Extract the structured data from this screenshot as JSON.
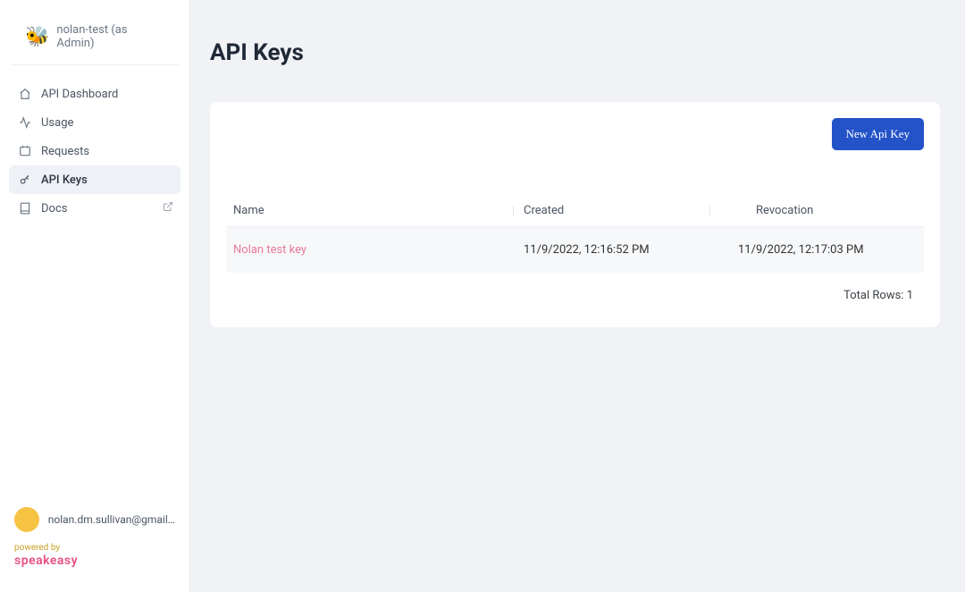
{
  "workspace": {
    "name": "nolan-test (as Admin)"
  },
  "sidebar": {
    "items": [
      {
        "label": "API Dashboard"
      },
      {
        "label": "Usage"
      },
      {
        "label": "Requests"
      },
      {
        "label": "API Keys"
      },
      {
        "label": "Docs"
      }
    ]
  },
  "user": {
    "email": "nolan.dm.sullivan@gmail..."
  },
  "footer": {
    "powered_by": "powered by",
    "brand": "speakeasy"
  },
  "page": {
    "title": "API Keys"
  },
  "toolbar": {
    "new_api_key_label": "New Api Key"
  },
  "table": {
    "columns": {
      "name": "Name",
      "created": "Created",
      "revocation": "Revocation"
    },
    "rows": [
      {
        "name": "Nolan test key",
        "created": "11/9/2022, 12:16:52 PM",
        "revocation": "11/9/2022, 12:17:03 PM"
      }
    ],
    "footer_label": "Total Rows:",
    "total_rows": "1"
  }
}
